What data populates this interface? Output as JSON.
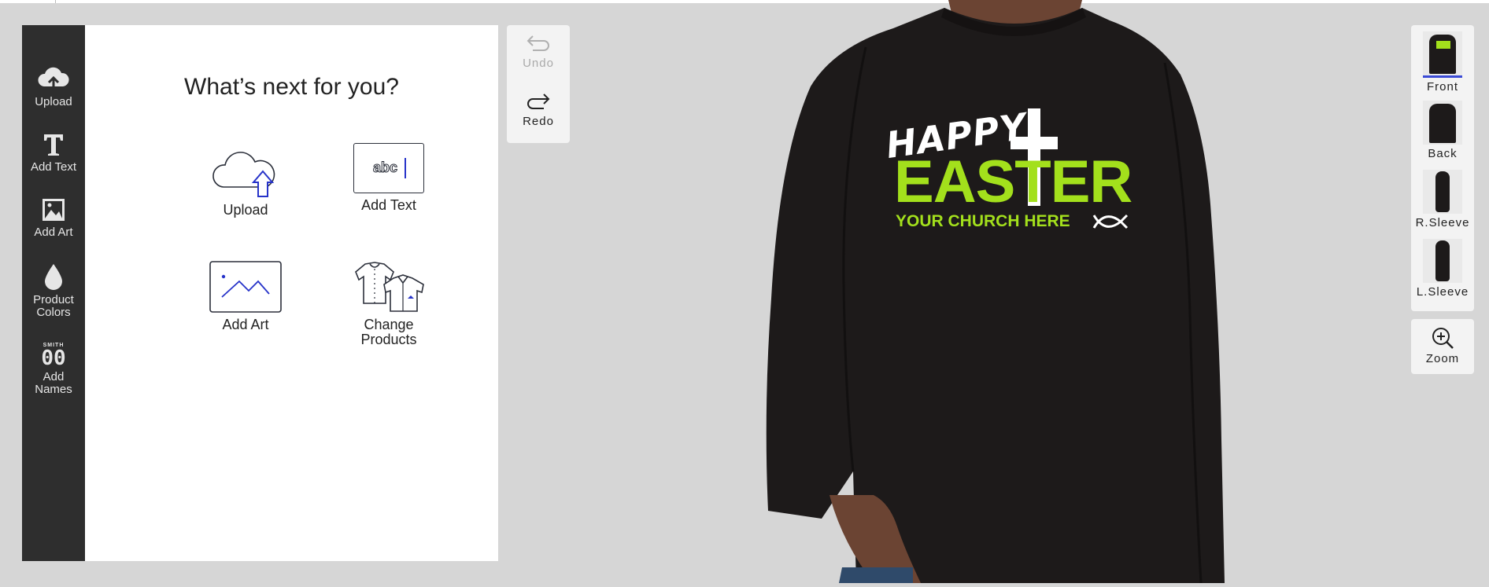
{
  "left_rail": {
    "items": [
      {
        "label": "Upload",
        "icon": "cloud-upload-icon"
      },
      {
        "label": "Add Text",
        "icon": "text-t-icon"
      },
      {
        "label": "Add Art",
        "icon": "image-icon"
      },
      {
        "label": "Product\nColors",
        "icon": "droplet-icon"
      },
      {
        "label": "Add\nNames",
        "icon": "jersey-number-icon"
      }
    ],
    "names_badge": "SMITH",
    "names_number": "00"
  },
  "panel": {
    "title": "What’s next for you?",
    "tiles": [
      {
        "label": "Upload"
      },
      {
        "label": "Add Text",
        "sample": "abc"
      },
      {
        "label": "Add Art"
      },
      {
        "label": "Change\nProducts"
      }
    ]
  },
  "history": {
    "undo": "Undo",
    "redo": "Redo"
  },
  "design": {
    "line1": "HAPPY",
    "line2": "EASTER",
    "line3": "YOUR CHURCH HERE",
    "shirt_color": "#1d1a1a",
    "accent_color": "#a3e01c"
  },
  "views": [
    {
      "label": "Front"
    },
    {
      "label": "Back"
    },
    {
      "label": "R.Sleeve"
    },
    {
      "label": "L.Sleeve"
    }
  ],
  "zoom_label": "Zoom",
  "colors": {
    "rail": "#2e2e2e",
    "accent_blue": "#2733c9",
    "background": "#d6d6d6"
  }
}
